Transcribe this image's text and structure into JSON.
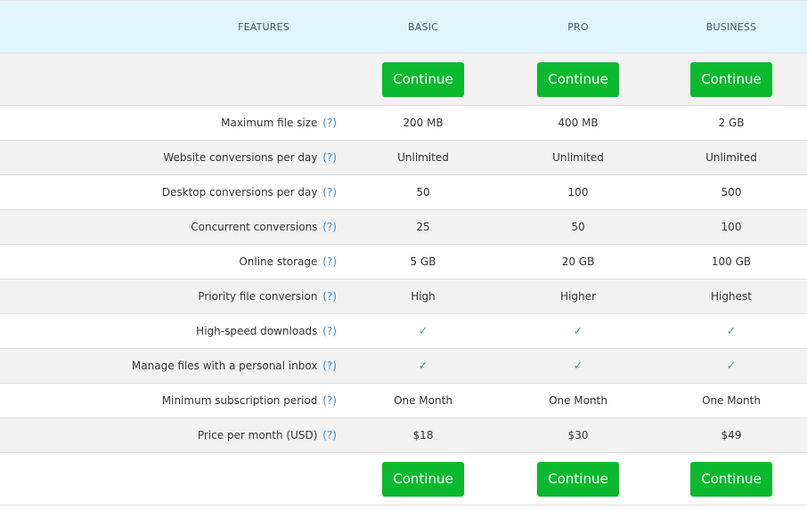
{
  "header": {
    "features": "FEATURES",
    "plans": [
      "BASIC",
      "PRO",
      "BUSINESS"
    ]
  },
  "button_label": "Continue",
  "help_marker": "(?)",
  "check_glyph": "✓",
  "colors": {
    "button": "#0bb92e",
    "header_bg": "#e0f5fd",
    "help_link": "#3a8fd0",
    "check": "#5aa07a"
  },
  "rows": [
    {
      "feature": "Maximum file size",
      "values": [
        "200 MB",
        "400 MB",
        "2 GB"
      ]
    },
    {
      "feature": "Website conversions per day",
      "values": [
        "Unlimited",
        "Unlimited",
        "Unlimited"
      ]
    },
    {
      "feature": "Desktop conversions per day",
      "values": [
        "50",
        "100",
        "500"
      ]
    },
    {
      "feature": "Concurrent conversions",
      "values": [
        "25",
        "50",
        "100"
      ]
    },
    {
      "feature": "Online storage",
      "values": [
        "5 GB",
        "20 GB",
        "100 GB"
      ]
    },
    {
      "feature": "Priority file conversion",
      "values": [
        "High",
        "Higher",
        "Highest"
      ]
    },
    {
      "feature": "High-speed downloads",
      "values": [
        "✓",
        "✓",
        "✓"
      ]
    },
    {
      "feature": "Manage files with a personal inbox",
      "values": [
        "✓",
        "✓",
        "✓"
      ]
    },
    {
      "feature": "Minimum subscription period",
      "values": [
        "One Month",
        "One Month",
        "One Month"
      ]
    },
    {
      "feature": "Price per month (USD)",
      "values": [
        "$18",
        "$30",
        "$49"
      ]
    }
  ]
}
